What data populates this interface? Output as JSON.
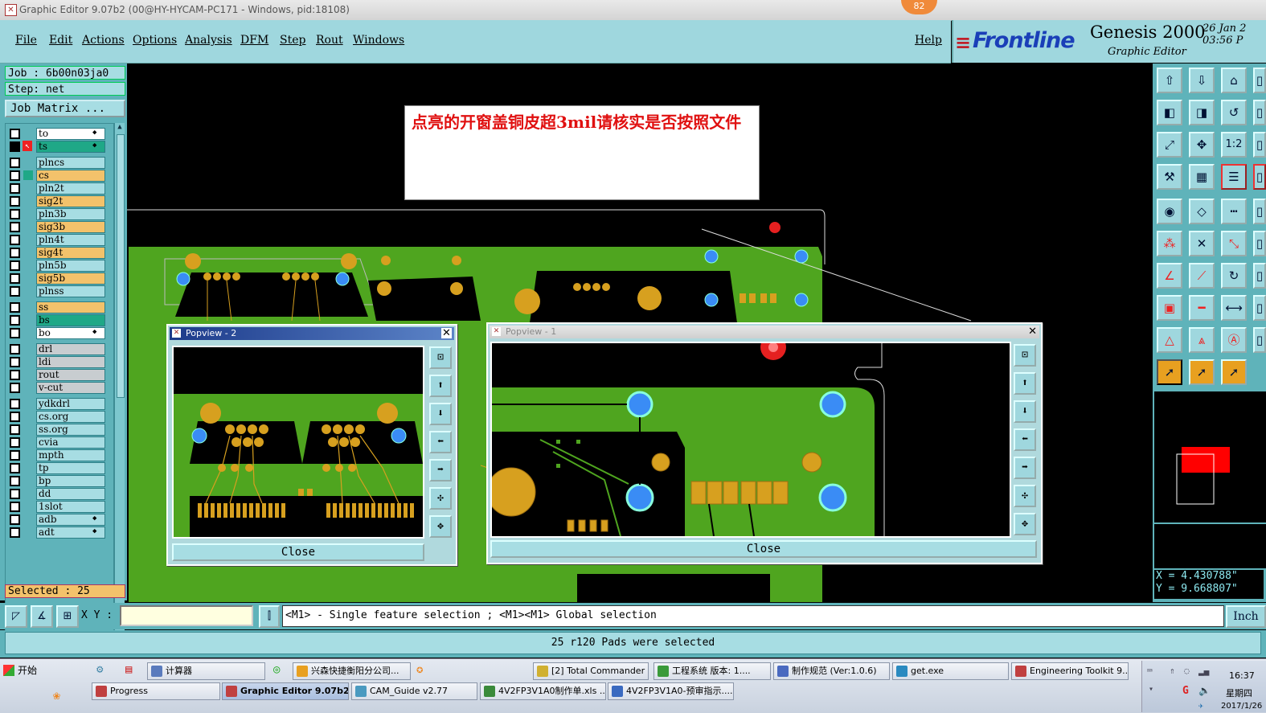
{
  "window": {
    "title": "Graphic Editor 9.07b2 (00@HY-HYCAM-PC171 - Windows, pid:18108)",
    "badge": "82"
  },
  "menu": [
    "File",
    "Edit",
    "Actions",
    "Options",
    "Analysis",
    "DFM",
    "Step",
    "Rout",
    "Windows"
  ],
  "help": "Help",
  "brand": {
    "logo": "Frontline",
    "product": "Genesis 2000",
    "subtitle": "Graphic Editor",
    "date": "26 Jan 2",
    "time": "03:56 P"
  },
  "left": {
    "job": "Job : 6b00n03ja0",
    "step": "Step: net",
    "job_matrix": "Job Matrix ...",
    "layers": [
      {
        "name": "to",
        "color": "#ffffff"
      },
      {
        "name": "ts",
        "color": "#1fa887"
      },
      {
        "name": "plncs",
        "color": "#a7dde3"
      },
      {
        "name": "cs",
        "color": "#f3c26b"
      },
      {
        "name": "pln2t",
        "color": "#a7dde3"
      },
      {
        "name": "sig2t",
        "color": "#f3c26b"
      },
      {
        "name": "pln3b",
        "color": "#a7dde3"
      },
      {
        "name": "sig3b",
        "color": "#f3c26b"
      },
      {
        "name": "pln4t",
        "color": "#a7dde3"
      },
      {
        "name": "sig4t",
        "color": "#f3c26b"
      },
      {
        "name": "pln5b",
        "color": "#a7dde3"
      },
      {
        "name": "sig5b",
        "color": "#f3c26b"
      },
      {
        "name": "plnss",
        "color": "#a7dde3"
      },
      {
        "name": "ss",
        "color": "#f3c26b"
      },
      {
        "name": "bs",
        "color": "#1fa887"
      },
      {
        "name": "bo",
        "color": "#ffffff"
      },
      {
        "name": "drl",
        "color": "#c8cdd0"
      },
      {
        "name": "ldi",
        "color": "#c8cdd0"
      },
      {
        "name": "rout",
        "color": "#c8cdd0"
      },
      {
        "name": "v-cut",
        "color": "#c8cdd0"
      },
      {
        "name": "ydkdrl",
        "color": "#a7dde3"
      },
      {
        "name": "cs.org",
        "color": "#a7dde3"
      },
      {
        "name": "ss.org",
        "color": "#a7dde3"
      },
      {
        "name": "cvia",
        "color": "#a7dde3"
      },
      {
        "name": "mpth",
        "color": "#a7dde3"
      },
      {
        "name": "tp",
        "color": "#a7dde3"
      },
      {
        "name": "bp",
        "color": "#a7dde3"
      },
      {
        "name": "dd",
        "color": "#a7dde3"
      },
      {
        "name": "1slot",
        "color": "#a7dde3"
      },
      {
        "name": "adb",
        "color": "#a7dde3"
      },
      {
        "name": "adt",
        "color": "#a7dde3"
      }
    ],
    "selected": "Selected : 25"
  },
  "note": "点亮的开窗盖铜皮超3mil请核实是否按照文件",
  "popview2": {
    "title": "Popview - 2",
    "close": "Close"
  },
  "popview1": {
    "title": "Popview - 1",
    "close": "Close"
  },
  "coords": {
    "x": "X = 4.430788\"",
    "y": "Y = 9.668807\""
  },
  "toolbar_right": {
    "scale_label": "1:2"
  },
  "command": {
    "xy_label": "X Y :",
    "hint": "<M1> - Single feature selection ; <M1><M1> Global selection",
    "inch": "Inch"
  },
  "status": "25 r120 Pads were selected",
  "taskbar": {
    "start": "开始",
    "row1": [
      {
        "label": "计算器",
        "color": "#5a7bbd"
      },
      {
        "label": "兴森快捷衡阳分公司...",
        "color": "#e8a020"
      },
      {
        "label": "[2] Total Commander ...",
        "color": "#d0b030"
      },
      {
        "label": "工程系统  版本: 1....",
        "color": "#3a9a3a"
      },
      {
        "label": "制作规范 (Ver:1.0.6)",
        "color": "#4a6ac0"
      },
      {
        "label": "get.exe",
        "color": "#2a8ac0"
      },
      {
        "label": "Engineering Toolkit 9....",
        "color": "#c04040"
      }
    ],
    "row2": [
      {
        "label": "Progress",
        "color": "#c04040"
      },
      {
        "label": "Graphic Editor 9.07b2 ...",
        "color": "#c04040"
      },
      {
        "label": "CAM_Guide v2.77",
        "color": "#4a9ac0"
      },
      {
        "label": "4V2FP3V1A0制作单.xls ...",
        "color": "#3a8a3a"
      },
      {
        "label": "4V2FP3V1A0-预审指示....",
        "color": "#3a6ac0"
      }
    ],
    "clock": "16:37",
    "weekday": "星期四",
    "date": "2017/1/26"
  }
}
